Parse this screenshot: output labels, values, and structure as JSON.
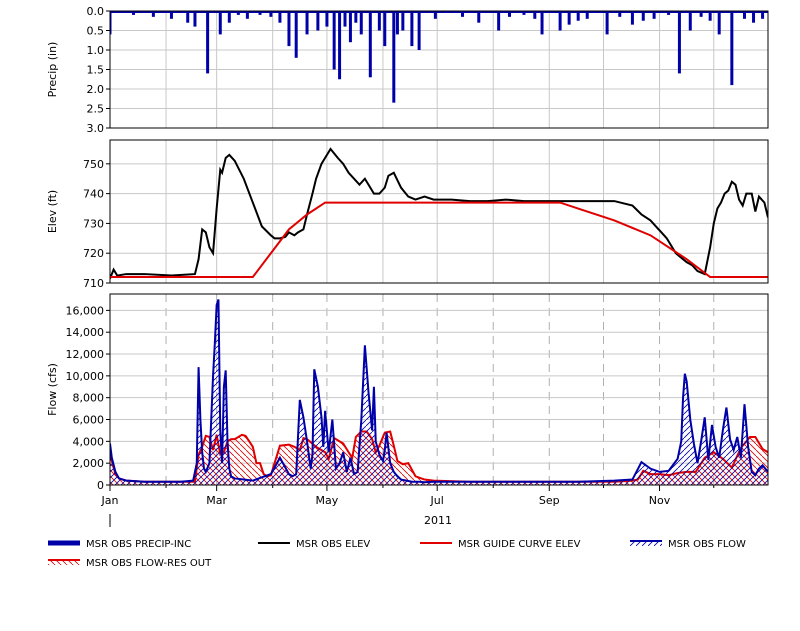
{
  "colors": {
    "precip": "#0000a8",
    "elev": "#000000",
    "guide": "#e00000",
    "flow": "#0000a8",
    "res_out": "#e00000",
    "grid": "#c8c8c8",
    "frame": "#000000"
  },
  "x_axis": {
    "month_labels": [
      "Jan",
      "Mar",
      "May",
      "Jul",
      "Sep",
      "Nov"
    ],
    "year_label": "2011",
    "range_day_of_year": [
      1,
      365
    ]
  },
  "legend": [
    {
      "label": "MSR OBS PRECIP-INC",
      "style": "thick-bar",
      "color": "#0000a8"
    },
    {
      "label": "MSR OBS ELEV",
      "style": "line",
      "color": "#000000"
    },
    {
      "label": "MSR GUIDE CURVE ELEV",
      "style": "line",
      "color": "#e00000"
    },
    {
      "label": "MSR OBS FLOW",
      "style": "hatched",
      "color": "#0000a8"
    },
    {
      "label": "MSR OBS FLOW-RES OUT",
      "style": "hatched",
      "color": "#e00000"
    }
  ],
  "chart_data": [
    {
      "type": "bar",
      "ylabel": "Precip (in)",
      "ylim": [
        0,
        3.0
      ],
      "y_inverted": true,
      "yticks": [
        "0.0",
        "0.5",
        "1.0",
        "1.5",
        "2.0",
        "2.5",
        "3.0"
      ],
      "grid": true,
      "series": [
        {
          "name": "MSR OBS PRECIP-INC",
          "x_day_of_year": [
            1,
            8,
            14,
            20,
            25,
            30,
            35,
            44,
            48,
            55,
            62,
            67,
            72,
            77,
            84,
            90,
            95,
            100,
            104,
            110,
            116,
            121,
            125,
            128,
            131,
            134,
            137,
            140,
            145,
            150,
            153,
            158,
            160,
            163,
            168,
            172,
            181,
            196,
            205,
            216,
            222,
            230,
            236,
            240,
            250,
            255,
            260,
            265,
            276,
            283,
            290,
            296,
            302,
            310,
            316,
            322,
            328,
            333,
            338,
            345,
            352,
            357,
            362
          ],
          "values": [
            0.6,
            0.05,
            0.1,
            0.05,
            0.15,
            0.05,
            0.2,
            0.3,
            0.4,
            1.6,
            0.6,
            0.3,
            0.1,
            0.2,
            0.1,
            0.15,
            0.3,
            0.9,
            1.2,
            0.6,
            0.5,
            0.4,
            1.5,
            1.75,
            0.4,
            0.8,
            0.3,
            0.6,
            1.7,
            0.5,
            0.9,
            2.35,
            0.6,
            0.5,
            0.9,
            1.0,
            0.2,
            0.15,
            0.3,
            0.5,
            0.15,
            0.1,
            0.2,
            0.6,
            0.5,
            0.35,
            0.25,
            0.2,
            0.6,
            0.15,
            0.35,
            0.25,
            0.2,
            0.1,
            1.6,
            0.5,
            0.15,
            0.25,
            0.6,
            1.9,
            0.2,
            0.3,
            0.2
          ]
        }
      ]
    },
    {
      "type": "line",
      "ylabel": "Elev (ft)",
      "ylim": [
        710,
        758
      ],
      "yticks": [
        "710",
        "720",
        "730",
        "740",
        "750"
      ],
      "grid": true,
      "series": [
        {
          "name": "MSR OBS ELEV",
          "x_day_of_year": [
            1,
            3,
            5,
            10,
            20,
            35,
            48,
            50,
            52,
            54,
            56,
            58,
            60,
            62,
            63,
            65,
            67,
            70,
            75,
            80,
            85,
            90,
            92,
            95,
            98,
            100,
            103,
            105,
            108,
            110,
            113,
            115,
            118,
            120,
            123,
            127,
            130,
            133,
            136,
            139,
            142,
            145,
            147,
            150,
            153,
            155,
            158,
            162,
            166,
            170,
            175,
            180,
            190,
            200,
            210,
            220,
            230,
            240,
            250,
            260,
            270,
            280,
            290,
            295,
            300,
            303,
            306,
            309,
            312,
            314,
            316,
            318,
            320,
            323,
            326,
            330,
            333,
            335,
            337,
            339,
            341,
            343,
            345,
            347,
            349,
            351,
            353,
            356,
            358,
            360,
            363,
            365
          ],
          "values": [
            711.5,
            714.5,
            712.5,
            713,
            713,
            712.5,
            713,
            718,
            728,
            727,
            722,
            720,
            735,
            748,
            747,
            752,
            753,
            751,
            745,
            737,
            729,
            726,
            725,
            725,
            725.5,
            727,
            726,
            727,
            728,
            733,
            740,
            745,
            750,
            752,
            755,
            752,
            750,
            747,
            745,
            743,
            745,
            742,
            740,
            740,
            742,
            746,
            747,
            742,
            739,
            738,
            739,
            738,
            738,
            737.5,
            737.5,
            738,
            737.5,
            737.5,
            737.5,
            737.5,
            737.5,
            737.5,
            736,
            733,
            731,
            729,
            727,
            725,
            722,
            720,
            719,
            718,
            717,
            716,
            714,
            713,
            722,
            730,
            735,
            737,
            740,
            741,
            744,
            743,
            738,
            736,
            740,
            740,
            734,
            739,
            737,
            732,
            725
          ]
        },
        {
          "name": "MSR GUIDE CURVE ELEV",
          "x_day_of_year": [
            1,
            80,
            90,
            100,
            110,
            120,
            160,
            200,
            250,
            260,
            280,
            300,
            320,
            333,
            365
          ],
          "values": [
            712,
            712,
            720,
            728,
            733,
            737,
            737,
            737,
            737,
            735,
            731,
            726,
            718,
            712,
            712
          ]
        }
      ]
    },
    {
      "type": "area",
      "ylabel": "Flow (cfs)",
      "ylim": [
        0,
        17500
      ],
      "yticks": [
        "0",
        "2,000",
        "4,000",
        "6,000",
        "8,000",
        "10,000",
        "12,000",
        "14,000",
        "16,000"
      ],
      "grid": true,
      "series": [
        {
          "name": "MSR OBS FLOW",
          "x_day_of_year": [
            1,
            2,
            4,
            6,
            10,
            20,
            30,
            40,
            47,
            49,
            50,
            51,
            52,
            53,
            54,
            56,
            58,
            59,
            60,
            61,
            62,
            63,
            64,
            65,
            66,
            67,
            68,
            70,
            75,
            80,
            85,
            90,
            95,
            98,
            100,
            102,
            104,
            106,
            108,
            110,
            112,
            113,
            114,
            116,
            118,
            119,
            120,
            122,
            124,
            126,
            128,
            130,
            132,
            134,
            136,
            138,
            140,
            142,
            144,
            146,
            147,
            148,
            150,
            152,
            153,
            154,
            156,
            158,
            160,
            162,
            165,
            168,
            170,
            172,
            175,
            180,
            200,
            240,
            260,
            280,
            290,
            295,
            300,
            305,
            310,
            315,
            317,
            318,
            319,
            320,
            322,
            324,
            326,
            328,
            330,
            332,
            334,
            336,
            338,
            340,
            342,
            344,
            346,
            348,
            350,
            352,
            354,
            356,
            358,
            360,
            362,
            365
          ],
          "values": [
            3800,
            2500,
            1200,
            600,
            400,
            300,
            300,
            300,
            400,
            2000,
            10800,
            6000,
            3000,
            1500,
            1200,
            2000,
            10000,
            13000,
            16500,
            17000,
            5000,
            2000,
            9000,
            10500,
            4000,
            1500,
            800,
            600,
            500,
            400,
            700,
            1000,
            2500,
            1600,
            1000,
            800,
            1000,
            7800,
            6200,
            4000,
            1500,
            2800,
            10600,
            9000,
            6200,
            3500,
            6800,
            3000,
            6000,
            1500,
            2000,
            3000,
            1200,
            2500,
            1000,
            1200,
            5900,
            12800,
            8500,
            5000,
            9000,
            4000,
            2800,
            2200,
            3200,
            4800,
            2000,
            1200,
            800,
            500,
            400,
            300,
            300,
            300,
            250,
            300,
            300,
            300,
            300,
            400,
            500,
            2100,
            1500,
            1200,
            1300,
            2400,
            4000,
            8000,
            10200,
            9500,
            6000,
            3800,
            2000,
            4000,
            6200,
            2300,
            5500,
            3500,
            2500,
            5000,
            7100,
            4200,
            3200,
            4400,
            2500,
            7400,
            3500,
            1200,
            900,
            1500,
            1800,
            1200
          ]
        },
        {
          "name": "MSR OBS FLOW-RES OUT",
          "x_day_of_year": [
            1,
            2,
            4,
            6,
            10,
            20,
            30,
            40,
            48,
            50,
            52,
            54,
            56,
            58,
            60,
            62,
            64,
            66,
            68,
            70,
            72,
            74,
            76,
            78,
            80,
            82,
            84,
            86,
            88,
            90,
            95,
            100,
            103,
            106,
            108,
            110,
            115,
            120,
            122,
            125,
            128,
            130,
            133,
            135,
            137,
            140,
            143,
            146,
            148,
            150,
            153,
            156,
            158,
            160,
            163,
            166,
            170,
            175,
            180,
            200,
            250,
            280,
            290,
            293,
            296,
            300,
            305,
            310,
            315,
            320,
            325,
            330,
            335,
            340,
            345,
            350,
            355,
            358,
            362,
            365
          ],
          "values": [
            2800,
            2200,
            1000,
            600,
            400,
            300,
            300,
            300,
            300,
            2800,
            3500,
            4500,
            4400,
            3200,
            4600,
            2800,
            3000,
            4000,
            4200,
            4200,
            4400,
            4600,
            4500,
            4000,
            3500,
            2000,
            2000,
            1000,
            800,
            900,
            3600,
            3700,
            3500,
            3200,
            4300,
            4200,
            3500,
            3000,
            2400,
            4300,
            4000,
            3800,
            3000,
            2500,
            4400,
            4900,
            4900,
            4200,
            3000,
            3600,
            4800,
            4900,
            3600,
            2200,
            1900,
            2000,
            800,
            500,
            400,
            300,
            300,
            300,
            400,
            500,
            1300,
            1000,
            1000,
            900,
            1100,
            1200,
            1200,
            2500,
            3000,
            2400,
            1600,
            3400,
            4400,
            4400,
            3300,
            3000
          ]
        }
      ]
    }
  ]
}
